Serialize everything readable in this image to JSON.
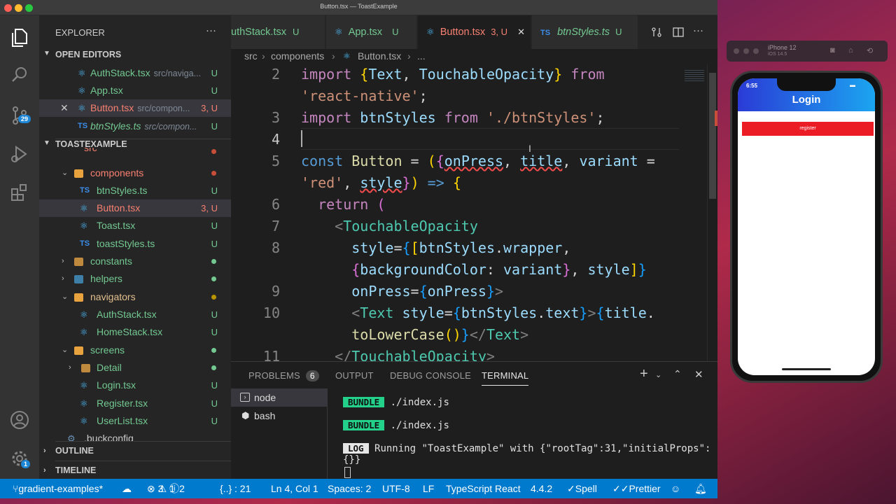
{
  "window": {
    "title": "Button.tsx — ToastExample"
  },
  "activity": {
    "scm_badge": "29",
    "accounts_badge": "1"
  },
  "sidebar": {
    "explorer_title": "EXPLORER",
    "more": "···",
    "open_editors_header": "OPEN EDITORS",
    "open_editors": [
      {
        "name": "AuthStack.tsx",
        "dir": "src/naviga...",
        "status": "U"
      },
      {
        "name": "App.tsx",
        "dir": "",
        "status": "U"
      },
      {
        "name": "Button.tsx",
        "dir": "src/compon...",
        "status": "3, U"
      },
      {
        "name": "btnStyles.ts",
        "dir": "src/compon...",
        "status": "U"
      }
    ],
    "project_header": "TOASTEXAMPLE",
    "tree": [
      {
        "name": "src"
      },
      {
        "name": "components"
      },
      {
        "name": "btnStyles.ts",
        "status": "U"
      },
      {
        "name": "Button.tsx",
        "status": "3, U"
      },
      {
        "name": "Toast.tsx",
        "status": "U"
      },
      {
        "name": "toastStyles.ts",
        "status": "U"
      },
      {
        "name": "constants"
      },
      {
        "name": "helpers"
      },
      {
        "name": "navigators"
      },
      {
        "name": "AuthStack.tsx",
        "status": "U"
      },
      {
        "name": "HomeStack.tsx",
        "status": "U"
      },
      {
        "name": "screens"
      },
      {
        "name": "Detail"
      },
      {
        "name": "Login.tsx",
        "status": "U"
      },
      {
        "name": "Register.tsx",
        "status": "U"
      },
      {
        "name": "UserList.tsx",
        "status": "U"
      },
      {
        "name": ".buckconfig"
      }
    ],
    "outline": "OUTLINE",
    "timeline": "TIMELINE"
  },
  "tabs": [
    {
      "name": "uthStack.tsx",
      "status": "U",
      "icon": "TS"
    },
    {
      "name": "App.tsx",
      "status": "U"
    },
    {
      "name": "Button.tsx",
      "status": "3, U",
      "close": "✕"
    },
    {
      "name": "btnStyles.ts",
      "status": "U",
      "icon": "TS"
    }
  ],
  "breadcrumb": {
    "a": "src",
    "b": "components",
    "c": "Button.tsx",
    "d": "..."
  },
  "code": {
    "l2": "2",
    "l3": "3",
    "l4": "4",
    "l5": "5",
    "l6": "6",
    "l7": "7",
    "l8": "8",
    "l9": "9",
    "l10": "10",
    "l11": "11",
    "t_import": "import",
    "t_text": "Text",
    "t_touch": "TouchableOpacity",
    "t_from": "from",
    "t_rn": "'react-native'",
    "t_btnStyles": "btnStyles",
    "t_path": "'./btnStyles'",
    "t_const": "const",
    "t_button": "Button",
    "t_onPress": "onPress",
    "t_title": "title",
    "t_variant": "variant",
    "t_red": "'red'",
    "t_style": "style",
    "t_return": "return",
    "t_wrapper": "wrapper",
    "t_bg": "backgroundColor",
    "t_text2": "text",
    "t_lower": "toLowerCase"
  },
  "panel": {
    "problems": "PROBLEMS",
    "problems_count": "6",
    "output": "OUTPUT",
    "debug": "DEBUG CONSOLE",
    "terminal": "TERMINAL",
    "terms": [
      "node",
      "bash"
    ],
    "bundle": "BUNDLE",
    "bundle_path": "./index.js",
    "log": "LOG",
    "log_text": "Running \"ToastExample\" with {\"rootTag\":31,\"initialProps\":",
    "log_text2": "{}}"
  },
  "status": {
    "branch": "gradient-examples*",
    "errors": "3",
    "warnings": "1",
    "infos": "2",
    "tsx": "{..} : 21",
    "position": "Ln 4, Col 1",
    "spaces": "Spaces: 2",
    "encoding": "UTF-8",
    "eol": "LF",
    "lang": "TypeScript React",
    "version": "4.4.2",
    "spell": "Spell",
    "prettier": "Prettier"
  },
  "simulator": {
    "device": "iPhone 12",
    "os": "iOS 14.5",
    "time": "6:55",
    "header": "Login",
    "button": "register"
  },
  "colors": {
    "accent": "#007acc",
    "untracked": "#73c991",
    "error": "#f88070",
    "register": "#ec1c24"
  }
}
